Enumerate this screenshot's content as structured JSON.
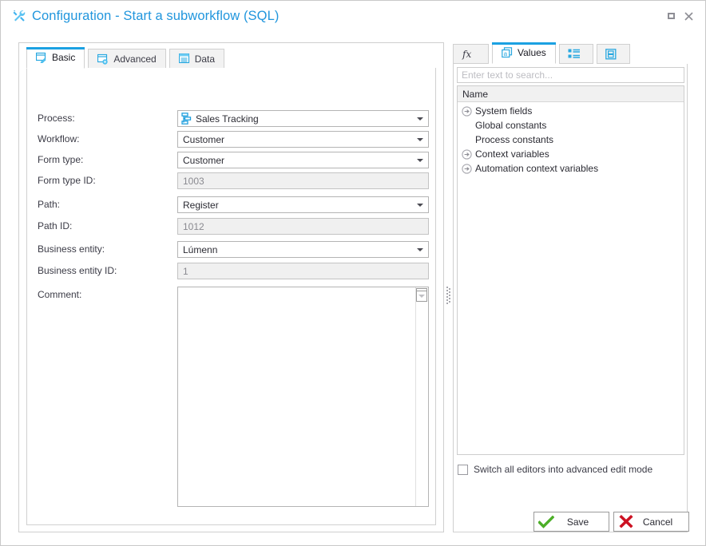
{
  "window": {
    "title": "Configuration - Start a subworkflow (SQL)",
    "title_icon": "tools-icon",
    "maximize_label": "Maximize",
    "close_label": "×"
  },
  "left_tabs": [
    {
      "label": "Basic",
      "icon": "form-pencil-icon",
      "active": true
    },
    {
      "label": "Advanced",
      "icon": "form-gear-icon",
      "active": false
    },
    {
      "label": "Data",
      "icon": "data-list-icon",
      "active": false
    }
  ],
  "form": {
    "rows": [
      {
        "label": "Process:",
        "value": "Sales Tracking",
        "type": "combo-icon",
        "icon": "process-diagram-icon",
        "readonly": false
      },
      {
        "label": "Workflow:",
        "value": "Customer",
        "type": "combo",
        "readonly": false
      },
      {
        "label": "Form type:",
        "value": "Customer",
        "type": "combo",
        "readonly": false
      },
      {
        "label": "Form type ID:",
        "value": "1003",
        "type": "text",
        "readonly": true
      },
      {
        "label": "Path:",
        "value": "Register",
        "type": "combo",
        "readonly": false
      },
      {
        "label": "Path ID:",
        "value": "1012",
        "type": "text",
        "readonly": true
      },
      {
        "label": "Business entity:",
        "value": "Lúmenn",
        "type": "combo",
        "readonly": false
      },
      {
        "label": "Business entity ID:",
        "value": "1",
        "type": "text",
        "readonly": true
      }
    ],
    "comment": {
      "label": "Comment:",
      "value": ""
    }
  },
  "right_tabs": [
    {
      "label": "",
      "icon": "function-fx-icon",
      "active": false
    },
    {
      "label": "Values",
      "icon": "values-a-icon",
      "active": true
    },
    {
      "label": "",
      "icon": "list-blocks-icon",
      "active": false
    },
    {
      "label": "",
      "icon": "form-box-icon",
      "active": false
    }
  ],
  "values_panel": {
    "search_placeholder": "Enter text to search...",
    "search_value": "",
    "column_header": "Name",
    "tree": [
      {
        "label": "System fields",
        "expandable": true
      },
      {
        "label": "Global constants",
        "expandable": false
      },
      {
        "label": "Process constants",
        "expandable": false
      },
      {
        "label": "Context variables",
        "expandable": true
      },
      {
        "label": "Automation context variables",
        "expandable": true
      }
    ],
    "switch_label": "Switch all editors into advanced edit mode",
    "switch_checked": false
  },
  "footer": {
    "save_label": "Save",
    "cancel_label": "Cancel"
  },
  "colors": {
    "accent": "#1ba1e2",
    "title": "#2196dd",
    "save_icon": "#4caf28",
    "cancel_icon": "#cc1122"
  }
}
